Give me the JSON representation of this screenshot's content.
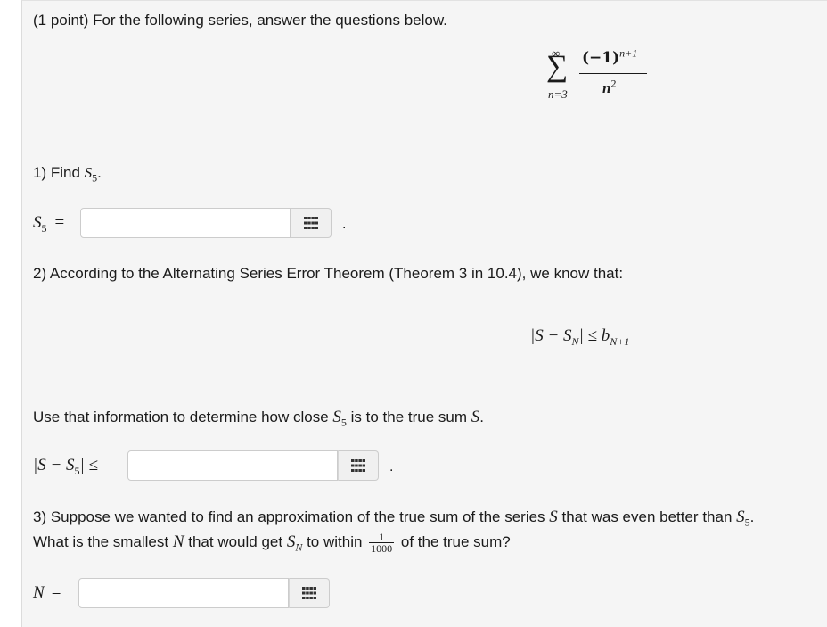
{
  "problem": {
    "header": "(1 point) For the following series, answer the questions below.",
    "series": {
      "upper_limit": "∞",
      "lower_limit": "n=3",
      "numerator": "(−1)",
      "numerator_exp": "n+1",
      "denominator": "n",
      "denominator_exp": "2"
    }
  },
  "part1": {
    "prompt_text": "1) Find ",
    "prompt_var": "S",
    "prompt_sub": "5",
    "prompt_end": ".",
    "label_var": "S",
    "label_sub": "5",
    "label_eq": "=",
    "input_value": "",
    "trailing": "."
  },
  "part2": {
    "prompt": "2) According to the Alternating Series Error Theorem (Theorem 3 in 10.4), we know that:",
    "theorem": {
      "left": "|S − S",
      "left_sub": "N",
      "rel": "| ≤ b",
      "right_sub": "N+1"
    },
    "followup_text": "Use that information to determine how close ",
    "followup_var": "S",
    "followup_sub": "5",
    "followup_mid": " is to the true sum ",
    "followup_var2": "S",
    "followup_end": ".",
    "label_left": "|S − S",
    "label_sub": "5",
    "label_rel": "| ≤",
    "input_value": "",
    "trailing": "."
  },
  "part3": {
    "line1_text": "3) Suppose we wanted to find an approximation of the true sum of the series ",
    "line1_var": "S",
    "line1_mid": " that was even better than ",
    "line1_var2": "S",
    "line1_sub": "5",
    "line1_end": ".",
    "line2_text": "What is the smallest ",
    "line2_var": "N",
    "line2_mid": " that would get ",
    "line2_var2": "S",
    "line2_sub": "N",
    "line2_mid2": " to within ",
    "frac_num": "1",
    "frac_den": "1000",
    "line2_end": " of the true sum?",
    "label_var": "N",
    "label_eq": "=",
    "input_value": ""
  },
  "icons": {
    "matrix_button": "grid-icon"
  }
}
